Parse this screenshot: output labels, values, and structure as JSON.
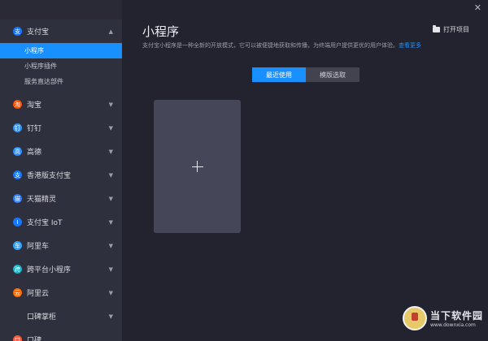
{
  "sidebar": {
    "groups": [
      {
        "label": "支付宝",
        "chev": "▲",
        "icon": "支",
        "icon_color": "#1677ff",
        "children": [
          {
            "label": "小程序"
          },
          {
            "label": "小程序插件"
          },
          {
            "label": "服务直达部件"
          }
        ]
      },
      {
        "label": "淘宝",
        "chev": "▼",
        "icon": "淘",
        "icon_color": "#ff5000"
      },
      {
        "label": "钉钉",
        "chev": "▼",
        "icon": "钉",
        "icon_color": "#3296fa"
      },
      {
        "label": "高德",
        "chev": "▼",
        "icon": "高",
        "icon_color": "#2b8cff"
      },
      {
        "label": "香港版支付宝",
        "chev": "▼",
        "icon": "支",
        "icon_color": "#1677ff"
      },
      {
        "label": "天猫精灵",
        "chev": "▼",
        "icon": "猫",
        "icon_color": "#2f7cf6"
      },
      {
        "label": "支付宝 IoT",
        "chev": "▼",
        "icon": "I",
        "icon_color": "#1677ff"
      },
      {
        "label": "阿里车",
        "chev": "▼",
        "icon": "车",
        "icon_color": "#2ea4ff"
      },
      {
        "label": "跨平台小程序",
        "chev": "▼",
        "icon": "跨",
        "icon_color": "#16b5c7"
      },
      {
        "label": "阿里云",
        "chev": "▼",
        "icon": "云",
        "icon_color": "#ff6a00"
      },
      {
        "label": "口碑掌柜",
        "chev": "▼"
      },
      {
        "label": "口碑",
        "icon": "口",
        "icon_color": "#ff5a3d"
      }
    ]
  },
  "main": {
    "title": "小程序",
    "open_project": "打开项目",
    "description": "支付宝小程序是一种全新的开放模式，它可以被便捷地获取和传播，为终端用户提供更优的用户体验。",
    "learn_more": "查看更多",
    "tabs": [
      "最近使用",
      "模版选取"
    ],
    "close": "✕"
  },
  "watermark": {
    "cn": "当下软件园",
    "url": "www.downxia.com"
  },
  "colors": {
    "accent": "#1890ff",
    "sidebar_bg": "#2f303d",
    "main_bg": "#23232f",
    "card_bg": "#454657"
  }
}
